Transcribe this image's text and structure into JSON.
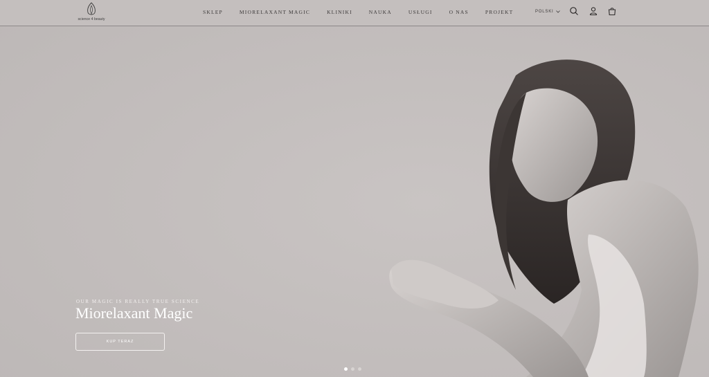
{
  "header": {
    "logo_text": "science 4 beauty",
    "nav": [
      {
        "label": "SKLEP"
      },
      {
        "label": "MIORELAXANT MAGIC"
      },
      {
        "label": "KLINIKI"
      },
      {
        "label": "NAUKA"
      },
      {
        "label": "USŁUGI"
      },
      {
        "label": "O NAS"
      },
      {
        "label": "PROJEKT"
      }
    ],
    "language": "POLSKI",
    "icons": [
      "search-icon",
      "account-icon",
      "cart-icon"
    ]
  },
  "hero": {
    "tagline": "OUR MAGIC IS REALLY TRUE SCIENCE",
    "title": "Miorelaxant Magic",
    "cta_label": "KUP TERAZ",
    "slides": 3,
    "active_slide": 1
  },
  "colors": {
    "background": "#c1bcbb",
    "header_border": "#8c8787",
    "text_dark": "#3d3a3a",
    "text_light": "#ffffff"
  }
}
